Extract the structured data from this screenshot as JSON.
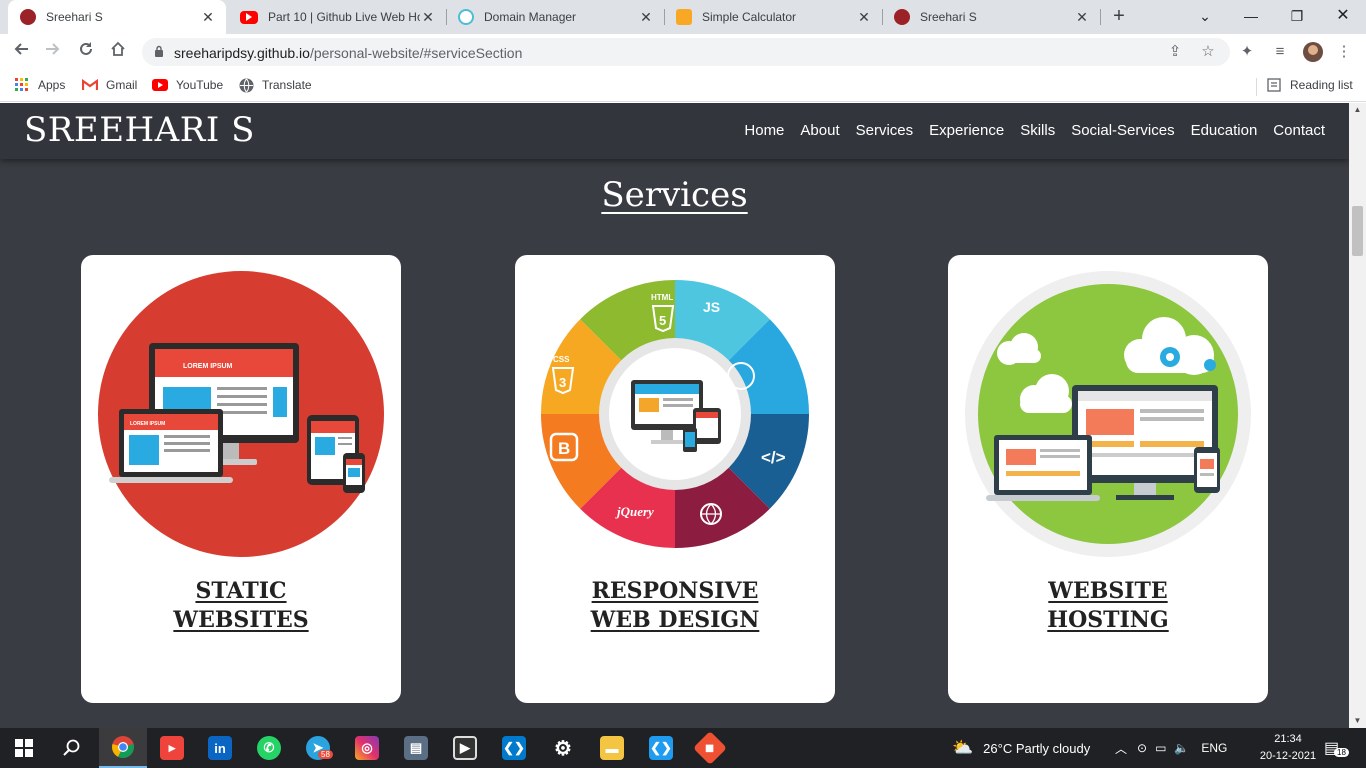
{
  "browser": {
    "tabs": [
      {
        "title": "Sreehari S",
        "active": true,
        "favicon": "profile-favicon"
      },
      {
        "title": "Part 10 | Github Live Web Ho",
        "active": false,
        "favicon": "youtube-favicon"
      },
      {
        "title": "Domain Manager",
        "active": false,
        "favicon": "domain-favicon"
      },
      {
        "title": "Simple Calculator",
        "active": false,
        "favicon": "calculator-favicon"
      },
      {
        "title": "Sreehari S",
        "active": false,
        "favicon": "profile-favicon"
      }
    ],
    "close_glyph": "✕",
    "new_tab_glyph": "+",
    "url_host": "sreeharipdsy.github.io",
    "url_path": "/personal-website/#serviceSection",
    "bookmarks": [
      {
        "label": "Apps",
        "icon": "apps-grid-icon"
      },
      {
        "label": "Gmail",
        "icon": "gmail-icon"
      },
      {
        "label": "YouTube",
        "icon": "youtube-icon"
      },
      {
        "label": "Translate",
        "icon": "translate-icon"
      }
    ],
    "reading_list": "Reading list"
  },
  "site": {
    "logo": "SREEHARI S",
    "nav": [
      "Home",
      "About",
      "Services",
      "Experience",
      "Skills",
      "Social-Services",
      "Education",
      "Contact"
    ],
    "section_title": "Services",
    "cards": [
      {
        "title_line1": "STATIC",
        "title_line2": "WEBSITES",
        "image": "static-websites-illustration"
      },
      {
        "title_line1": "RESPONSIVE",
        "title_line2": "WEB DESIGN",
        "image": "responsive-web-design-illustration"
      },
      {
        "title_line1": "WEBSITE",
        "title_line2": "HOSTING",
        "image": "website-hosting-illustration"
      }
    ],
    "illustration_text": {
      "lorem": "LOREM IPSUM",
      "html": "HTML",
      "js": "JS",
      "css": "CSS",
      "jquery": "jQuery",
      "b": "B",
      "five": "5",
      "three": "3",
      "js_glyph": "JS",
      "code": "</>"
    }
  },
  "taskbar": {
    "apps": [
      "start-icon",
      "search-icon",
      "chrome-icon",
      "anydesk-icon",
      "linkedin-icon",
      "whatsapp-icon",
      "telegram-icon",
      "instagram-icon",
      "server-icon",
      "media-icon",
      "vscode-icon",
      "settings-icon",
      "file-explorer-icon",
      "vscode-insiders-icon",
      "git-icon"
    ],
    "telegram_badge": "58",
    "weather": "26°C  Partly cloudy",
    "language": "ENG",
    "time": "21:34",
    "date": "20-12-2021",
    "notifications": "18"
  },
  "colors": {
    "page_bg": "#393c42",
    "header_bg": "#32353b",
    "card_bg": "#ffffff",
    "static_red": "#d63c2f",
    "hosting_green": "#8dc63f"
  }
}
